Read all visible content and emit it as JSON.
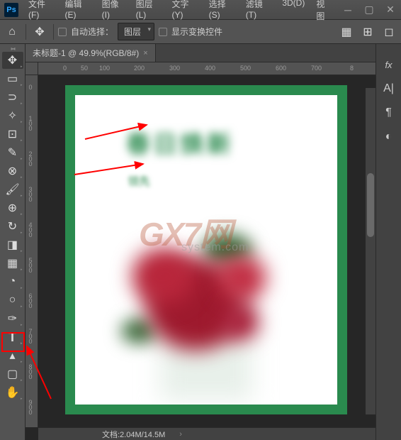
{
  "app_logo": "Ps",
  "menu": [
    "文件(F)",
    "编辑(E)",
    "图像(I)",
    "图层(L)",
    "文字(Y)",
    "选择(S)",
    "滤镜(T)",
    "3D(D)",
    "视图"
  ],
  "options": {
    "auto_select_label": "自动选择：",
    "layer_dropdown": "图层",
    "show_transform_label": "显示变换控件"
  },
  "doc_tab": "未标题-1 @ 49.9%(RGB/8#)",
  "ruler_h": [
    "0",
    "50",
    "100",
    "200",
    "300",
    "400",
    "500",
    "600",
    "700",
    "8"
  ],
  "ruler_v": [
    "0",
    "100",
    "200",
    "300",
    "400",
    "500",
    "600",
    "700",
    "800",
    "900"
  ],
  "canvas_text": {
    "title": "春日焕新",
    "subtitle": "领先",
    "watermark": "GX7网",
    "watermark_sub": "system.com"
  },
  "status": {
    "doc_info": "文档:2.04M/14.5M"
  },
  "tools": [
    "move",
    "rect-select",
    "lasso",
    "magic-wand",
    "crop",
    "eyedropper",
    "patch",
    "brush",
    "stamp",
    "history-brush",
    "eraser",
    "gradient",
    "blur",
    "dodge",
    "pen",
    "type",
    "path-select",
    "rectangle",
    "hand"
  ],
  "right_panel_icons": [
    "fx",
    "char",
    "para",
    "swatch"
  ]
}
